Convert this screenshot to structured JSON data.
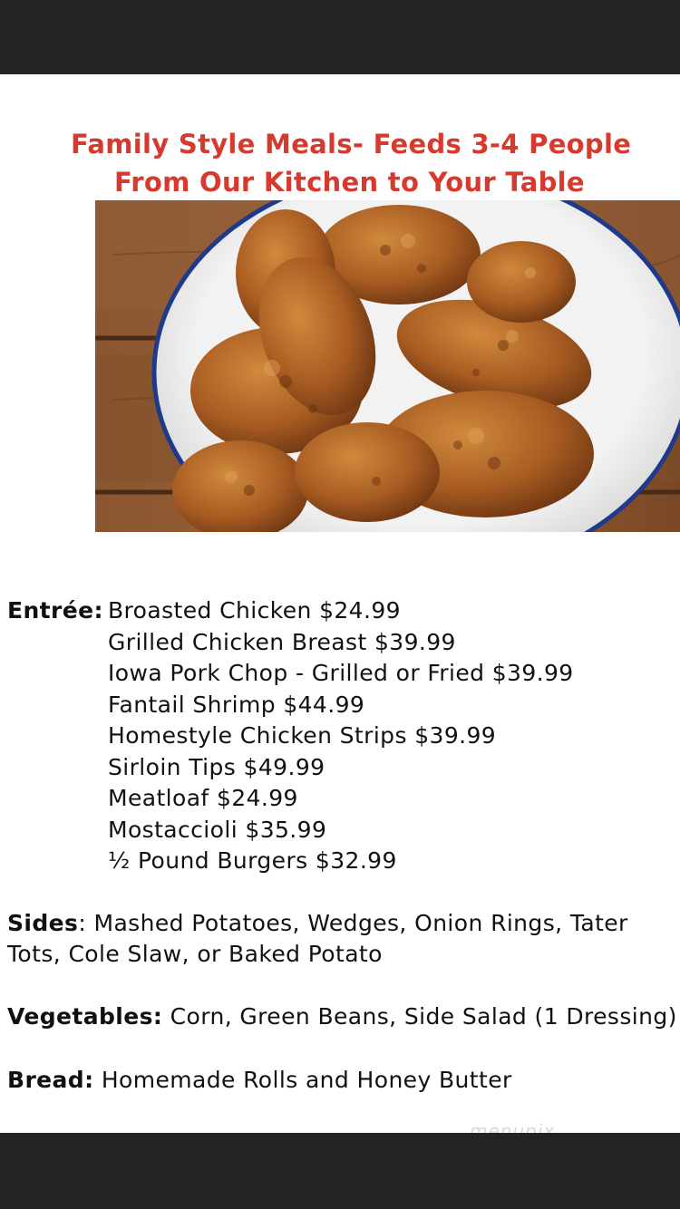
{
  "header": {
    "title_line1": "Family Style Meals- Feeds 3-4 People",
    "title_line2": "From Our Kitchen to Your Table"
  },
  "entree": {
    "label": "Entrée:",
    "items": [
      "Broasted Chicken $24.99",
      "Grilled Chicken Breast $39.99",
      "Iowa Pork Chop - Grilled or Fried $39.99",
      "Fantail Shrimp $44.99",
      "Homestyle Chicken Strips $39.99",
      "Sirloin Tips $49.99",
      "Meatloaf $24.99",
      "Mostaccioli $35.99",
      "½ Pound Burgers $32.99"
    ]
  },
  "sides": {
    "label": "Sides",
    "line1": ": Mashed Potatoes, Wedges, Onion Rings, Tater",
    "line2": "Tots, Cole Slaw, or Baked Potato"
  },
  "vegetables": {
    "label": "Vegetables:",
    "text": " Corn, Green Beans, Side Salad (1 Dressing)"
  },
  "bread": {
    "label": "Bread:",
    "text": " Homemade Rolls and Honey Butter"
  },
  "watermark": "menupix",
  "colors": {
    "title": "#d63a2f",
    "frame": "#232323",
    "page": "#ffffff"
  }
}
